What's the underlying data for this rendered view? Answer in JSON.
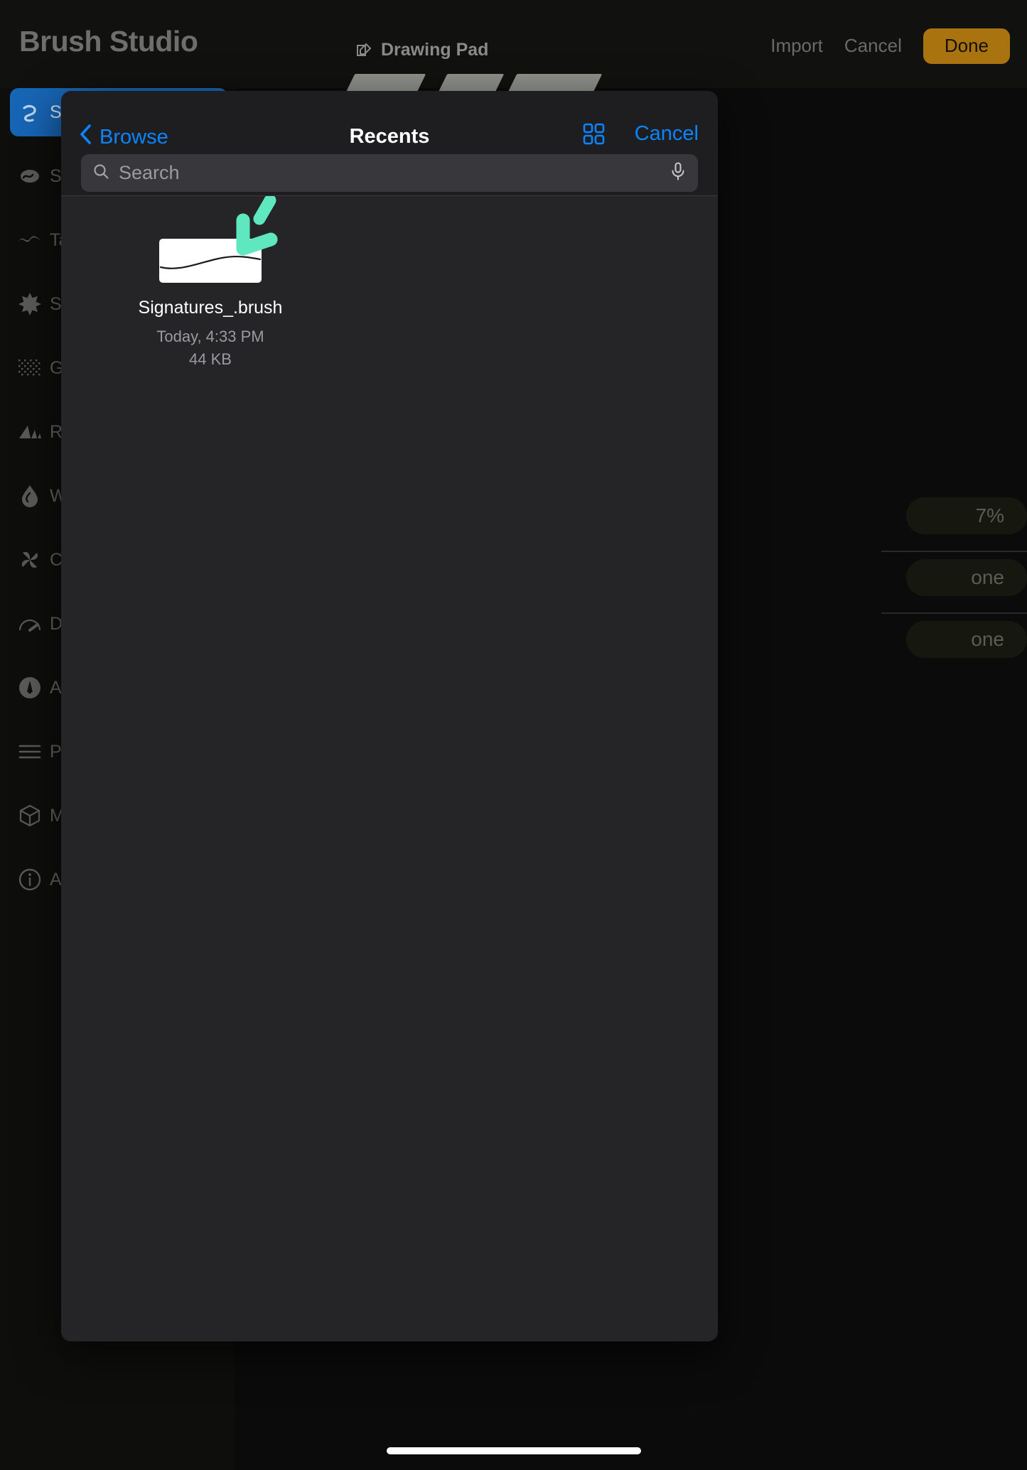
{
  "app": {
    "title": "Brush Studio",
    "document_chip": {
      "icon": "compose-icon",
      "label": "Drawing Pad"
    },
    "actions": {
      "import_label": "Import",
      "cancel_label": "Cancel",
      "done_label": "Done"
    },
    "accent_done_bg": "#a9740f",
    "accent_blue": "#0a84ff",
    "sidebar": {
      "items": [
        {
          "icon": "stroke-path-icon",
          "label": "Stroke Path",
          "active": true
        },
        {
          "icon": "stabilization-icon",
          "label": "Stabilization",
          "active": false
        },
        {
          "icon": "taper-icon",
          "label": "Taper",
          "active": false
        },
        {
          "icon": "shape-icon",
          "label": "Shape",
          "active": false
        },
        {
          "icon": "grain-icon",
          "label": "Grain",
          "active": false
        },
        {
          "icon": "rendering-icon",
          "label": "Rendering",
          "active": false
        },
        {
          "icon": "wet-mix-icon",
          "label": "Wet Mix",
          "active": false
        },
        {
          "icon": "color-dynamics-icon",
          "label": "Color Dynamics",
          "active": false
        },
        {
          "icon": "dynamics-icon",
          "label": "Dynamics",
          "active": false
        },
        {
          "icon": "apple-pencil-icon",
          "label": "Apple Pencil",
          "active": false
        },
        {
          "icon": "properties-icon",
          "label": "Properties",
          "active": false
        },
        {
          "icon": "materials-icon",
          "label": "Materials",
          "active": false
        },
        {
          "icon": "about-icon",
          "label": "About this brush",
          "active": false
        }
      ]
    },
    "background_values": [
      {
        "value": "7%"
      },
      {
        "value": "one"
      },
      {
        "value": "one"
      }
    ]
  },
  "modal": {
    "back_label": "Browse",
    "title": "Recents",
    "grid_icon": "grid-view-icon",
    "cancel_label": "Cancel",
    "search": {
      "icon": "search-icon",
      "placeholder": "Search",
      "value": "",
      "mic_icon": "microphone-icon"
    },
    "files": [
      {
        "name": "Signatures_.brush",
        "date": "Today, 4:33 PM",
        "size": "44 KB",
        "thumb": "brush-stroke-thumbnail"
      }
    ]
  },
  "annotation": {
    "type": "arrow-down-left",
    "color": "#5fe8c0"
  },
  "system": {
    "home_indicator": "home-indicator"
  }
}
